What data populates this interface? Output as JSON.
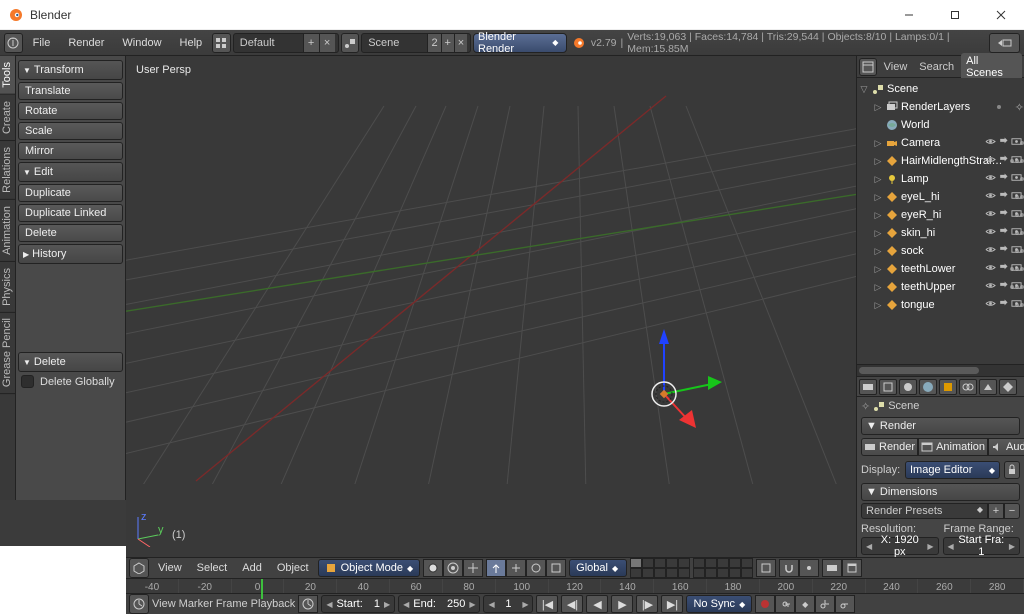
{
  "window_title": "Blender",
  "menubar": {
    "file": "File",
    "render": "Render",
    "window": "Window",
    "help": "Help",
    "layout_label": "Default",
    "scene_label": "Scene",
    "engine_label": "Blender Render",
    "version": "v2.79",
    "stats": "Verts:19,063 | Faces:14,784 | Tris:29,544 | Objects:8/10 | Lamps:0/1 | Mem:15.85M"
  },
  "tool_tabs": [
    "Tools",
    "Create",
    "Relations",
    "Animation",
    "Physics",
    "Grease Pencil"
  ],
  "tool_panel": {
    "transform": {
      "title": "Transform",
      "translate": "Translate",
      "rotate": "Rotate",
      "scale": "Scale",
      "mirror": "Mirror"
    },
    "edit": {
      "title": "Edit",
      "duplicate": "Duplicate",
      "dup_linked": "Duplicate Linked",
      "delete": "Delete"
    },
    "history": {
      "title": "History"
    },
    "delete_panel": {
      "title": "Delete",
      "globally": "Delete Globally"
    }
  },
  "viewport": {
    "label": "User Persp",
    "frame_label": "(1)"
  },
  "view_footer": {
    "view": "View",
    "select": "Select",
    "add": "Add",
    "object": "Object",
    "mode": "Object Mode",
    "orient": "Global"
  },
  "outliner": {
    "menus": {
      "view": "View",
      "search": "Search",
      "all": "All Scenes"
    },
    "root": "Scene",
    "renderlayers": "RenderLayers",
    "world": "World",
    "items": [
      {
        "name": "Camera",
        "icon": "camera",
        "tri": "▷",
        "dots": 1,
        "vis": true
      },
      {
        "name": "HairMidlengthStraight",
        "icon": "mesh",
        "tri": "▷",
        "dots": 3,
        "vis": true,
        "trunc": true
      },
      {
        "name": "Lamp",
        "icon": "lamp",
        "tri": "▷",
        "dots": 1,
        "vis": true
      },
      {
        "name": "eyeL_hi",
        "icon": "mesh",
        "tri": "▷",
        "dots": 2,
        "vis": true
      },
      {
        "name": "eyeR_hi",
        "icon": "mesh",
        "tri": "▷",
        "dots": 2,
        "vis": true
      },
      {
        "name": "skin_hi",
        "icon": "mesh",
        "tri": "▷",
        "dots": 2,
        "vis": true
      },
      {
        "name": "sock",
        "icon": "mesh",
        "tri": "▷",
        "dots": 2,
        "vis": true
      },
      {
        "name": "teethLower",
        "icon": "mesh",
        "tri": "▷",
        "dots": 3,
        "vis": true
      },
      {
        "name": "teethUpper",
        "icon": "mesh",
        "tri": "▷",
        "dots": 3,
        "vis": true
      },
      {
        "name": "tongue",
        "icon": "mesh",
        "tri": "▷",
        "dots": 2,
        "vis": true
      }
    ]
  },
  "props": {
    "crumb": "Scene",
    "render": {
      "title": "Render",
      "render": "Render",
      "anim": "Animation",
      "audio": "Audio",
      "display_label": "Display:",
      "display_value": "Image Editor"
    },
    "dims": {
      "title": "Dimensions",
      "preset": "Render Presets",
      "res": "Resolution:",
      "frange": "Frame Range:",
      "x": "X: 1920 px",
      "startfra": "Start Fra: 1"
    }
  },
  "timeline": {
    "menus": {
      "view": "View",
      "marker": "Marker",
      "frame": "Frame",
      "playback": "Playback"
    },
    "start": {
      "label": "Start:",
      "value": "1"
    },
    "end": {
      "label": "End:",
      "value": "250"
    },
    "cur": "1",
    "sync": "No Sync",
    "ticks": [
      "-40",
      "-20",
      "0",
      "20",
      "40",
      "60",
      "80",
      "100",
      "120",
      "140",
      "160",
      "180",
      "200",
      "220",
      "240",
      "260",
      "280"
    ]
  }
}
